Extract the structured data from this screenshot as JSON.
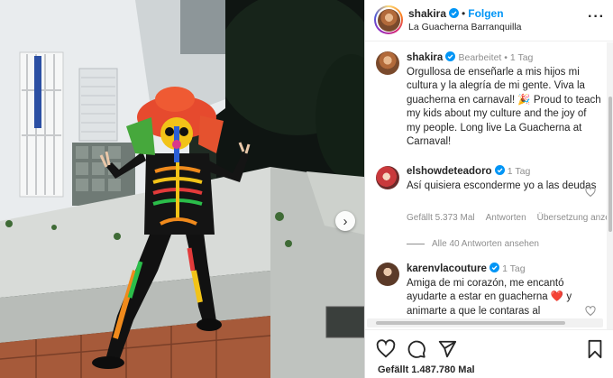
{
  "post": {
    "username": "shakira",
    "follow_label": "Folgen",
    "location": "La Guacherna Barranquilla",
    "caption_author": "shakira",
    "caption_edited": "Bearbeitet",
    "caption_time": "1 Tag",
    "caption_text": "Orgullosa de enseñarle a mis hijos mi cultura y la alegría de mi gente. Viva la guacherna en carnaval! 🎉 Proud to teach my kids about my culture and the joy of my people. Long live La Guacherna at Carnaval!",
    "likes": "Gefällt 1.487.780 Mal"
  },
  "comments": [
    {
      "username": "elshowdeteadoro",
      "time": "1 Tag",
      "text": "Así quisiera esconderme yo a las deudas",
      "likes": "Gefällt 5.373 Mal",
      "reply": "Antworten",
      "translate": "Übersetzung anzeigen",
      "view_replies": "Alle 40 Antworten ansehen"
    },
    {
      "username": "karenvlacouture",
      "time": "1 Tag",
      "text": "Amiga de mi corazón, me encantó ayudarte a estar en guacherna ❤️ y animarte a que le contaras al"
    }
  ],
  "colors": {
    "accent": "#0095f6",
    "verified": "#0095f6",
    "text": "#262626",
    "muted": "#8e8e8e"
  },
  "icons": [
    "more-options-icon",
    "verified-icon",
    "heart-icon",
    "comment-icon",
    "share-icon",
    "bookmark-icon",
    "next-arrow-icon"
  ]
}
